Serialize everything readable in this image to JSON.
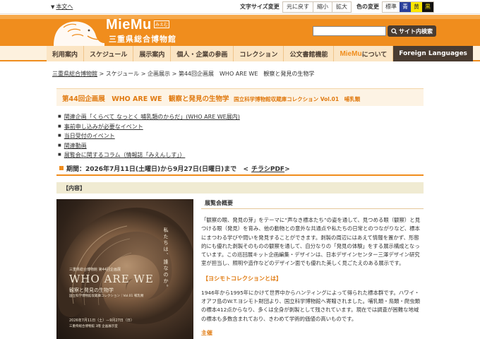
{
  "utility": {
    "skip_link": "本文へ",
    "font_size_label": "文字サイズ変更",
    "font_buttons": [
      "元に戻す",
      "縮小",
      "拡大"
    ],
    "color_label": "色の変更",
    "color_buttons": [
      "標準",
      "青",
      "黄",
      "黒"
    ]
  },
  "header": {
    "logo": "MieMu",
    "logo_sub": "みえむ",
    "logo_jp": "三重県総合博物館",
    "search_button": "サイト内検索",
    "search_placeholder": ""
  },
  "nav": {
    "items": [
      "利用案内",
      "スケジュール",
      "展示案内",
      "個人・企業の参画",
      "コレクション",
      "公文書館機能"
    ],
    "about_brand": "MieMu",
    "about_suffix": "について",
    "foreign": "Foreign Languages"
  },
  "breadcrumb": {
    "home": "三重県総合博物館",
    "level1": "スケジュール",
    "level2": "企画展示",
    "current": "第44回企画展　WHO ARE WE　観察と発見の生物学"
  },
  "title": {
    "main": "第44回企画展　WHO ARE WE　観察と発見の生物学",
    "sub": "国立科学博物館収蔵庫コレクション Vol.01　哺乳類"
  },
  "links": [
    "関連企画「くらべて なっとく 哺乳類のからだ」(WHO ARE WE展内)",
    "事前申し込みが必要なイベント",
    "当日受付のイベント",
    "関連動画",
    "展覧会に関するコラム（情報誌「みえんしす」）"
  ],
  "period": {
    "text": "期間：2026年7月11日(土曜日)から9月27日(日曜日)まで",
    "pdf_link": "チラシPDF"
  },
  "section": {
    "label": "【内容】"
  },
  "poster": {
    "side_text": "私たちは、誰なのか。",
    "small_top": "三重県総合博物館 第44回企画展",
    "main": "WHO ARE WE",
    "sub1": "観察と発見の生物学",
    "sub2": "国立科学博物館収蔵庫コレクション｜Vol.01 哺乳類",
    "dates": "2026年7月11日（土）—9月27日（日）",
    "venue": "三重県総合博物館 3階 企画展示室"
  },
  "content": {
    "overview_heading": "展覧会概要",
    "overview_text": "「観察の眼、発見の芽」をテーマに“声なき標本たち”の姿を通して、見つめる眼（観察）と見つける眼（発見）を育み、他の動物との意外な共通点や私たちの日常とのつながりなど、標本にまつわる学びや問いを発見することができます。剥製の周辺にはあえて情報を置かず、形態的にも優れた剥製そのものの観察を通して、自分なりの「発見の体験」をする展示構成となっています。この巡回展キット企画編集・デザインは、日本デザインセンター三澤デザイン研究室が担当し、照明や造作などのデザイン面でも優れた美しく見ごたえのある展示です。",
    "yoshimoto_heading": "【ヨシモトコレクションとは】",
    "yoshimoto_text": "1946年から1995年にかけて世界中からハンティングによって得られた標本群です。ハワイ・オアフ島のW.T.ヨシモト財団より、国立科学博物館へ寄贈されました。哺乳類・鳥類・爬虫類の標本412点からなり、多くは全身が剥製として残されています。現在では調査が困難な地域の標本も多数含まれており、きわめて学術的価値の高いものです。",
    "next_heading": "主催"
  }
}
